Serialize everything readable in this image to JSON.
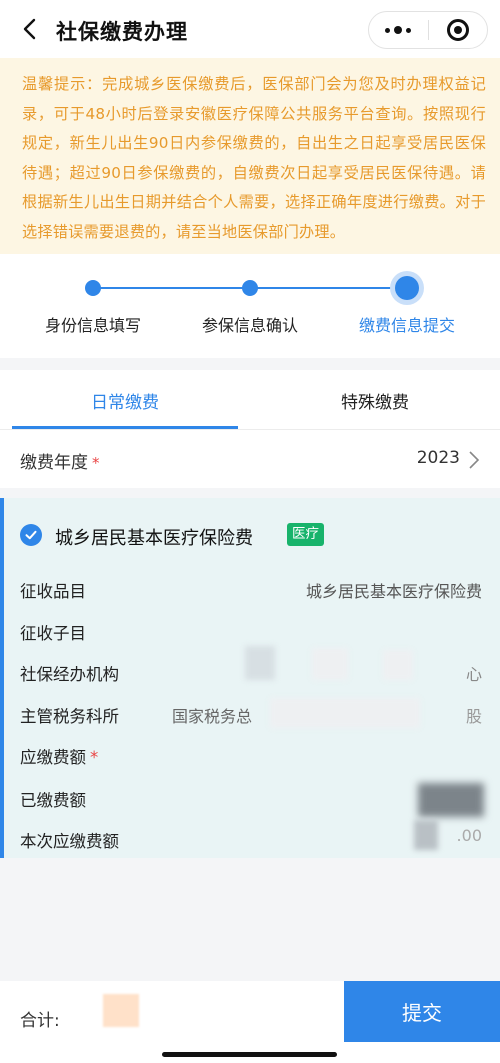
{
  "header": {
    "title": "社保缴费办理",
    "back_icon": "chevron-left-icon",
    "more_icon": "more-dots-icon",
    "close_icon": "target-close-icon"
  },
  "notice": {
    "text": "温馨提示：完成城乡医保缴费后，医保部门会为您及时办理权益记录，可于48小时后登录安徽医疗保障公共服务平台查询。按照现行规定，新生儿出生90日内参保缴费的，自出生之日起享受居民医保待遇；超过90日参保缴费的，自缴费次日起享受居民医保待遇。请根据新生儿出生日期并结合个人需要，选择正确年度进行缴费。对于选择错误需要退费的，请至当地医保部门办理。",
    "color": "#e79a2c",
    "background": "#fdf6e3"
  },
  "steps": [
    {
      "label": "身份信息填写",
      "state": "done"
    },
    {
      "label": "参保信息确认",
      "state": "done"
    },
    {
      "label": "缴费信息提交",
      "state": "active"
    }
  ],
  "tabs": [
    {
      "label": "日常缴费",
      "active": true
    },
    {
      "label": "特殊缴费",
      "active": false
    }
  ],
  "year_row": {
    "label": "缴费年度",
    "required_mark": "*",
    "value": "2023"
  },
  "card": {
    "title": "城乡居民基本医疗保险费",
    "tag": "医疗",
    "fields": [
      {
        "label": "征收品目",
        "value": "城乡居民基本医疗保险费"
      },
      {
        "label": "征收子目",
        "value": ""
      },
      {
        "label": "社保经办机构",
        "value": "心"
      },
      {
        "label": "主管税务科所",
        "value": "国家税务总",
        "value_end": "股"
      },
      {
        "label": "应缴费额",
        "required_mark": "*",
        "value": ""
      },
      {
        "label": "已缴费额",
        "value": ""
      },
      {
        "label": "本次应缴费额",
        "value": ".00"
      }
    ]
  },
  "bottom": {
    "total_label": "合计:",
    "submit_label": "提交"
  },
  "colors": {
    "accent": "#2f86e8",
    "tag_green": "#18b36b",
    "required_red": "#e94545"
  }
}
